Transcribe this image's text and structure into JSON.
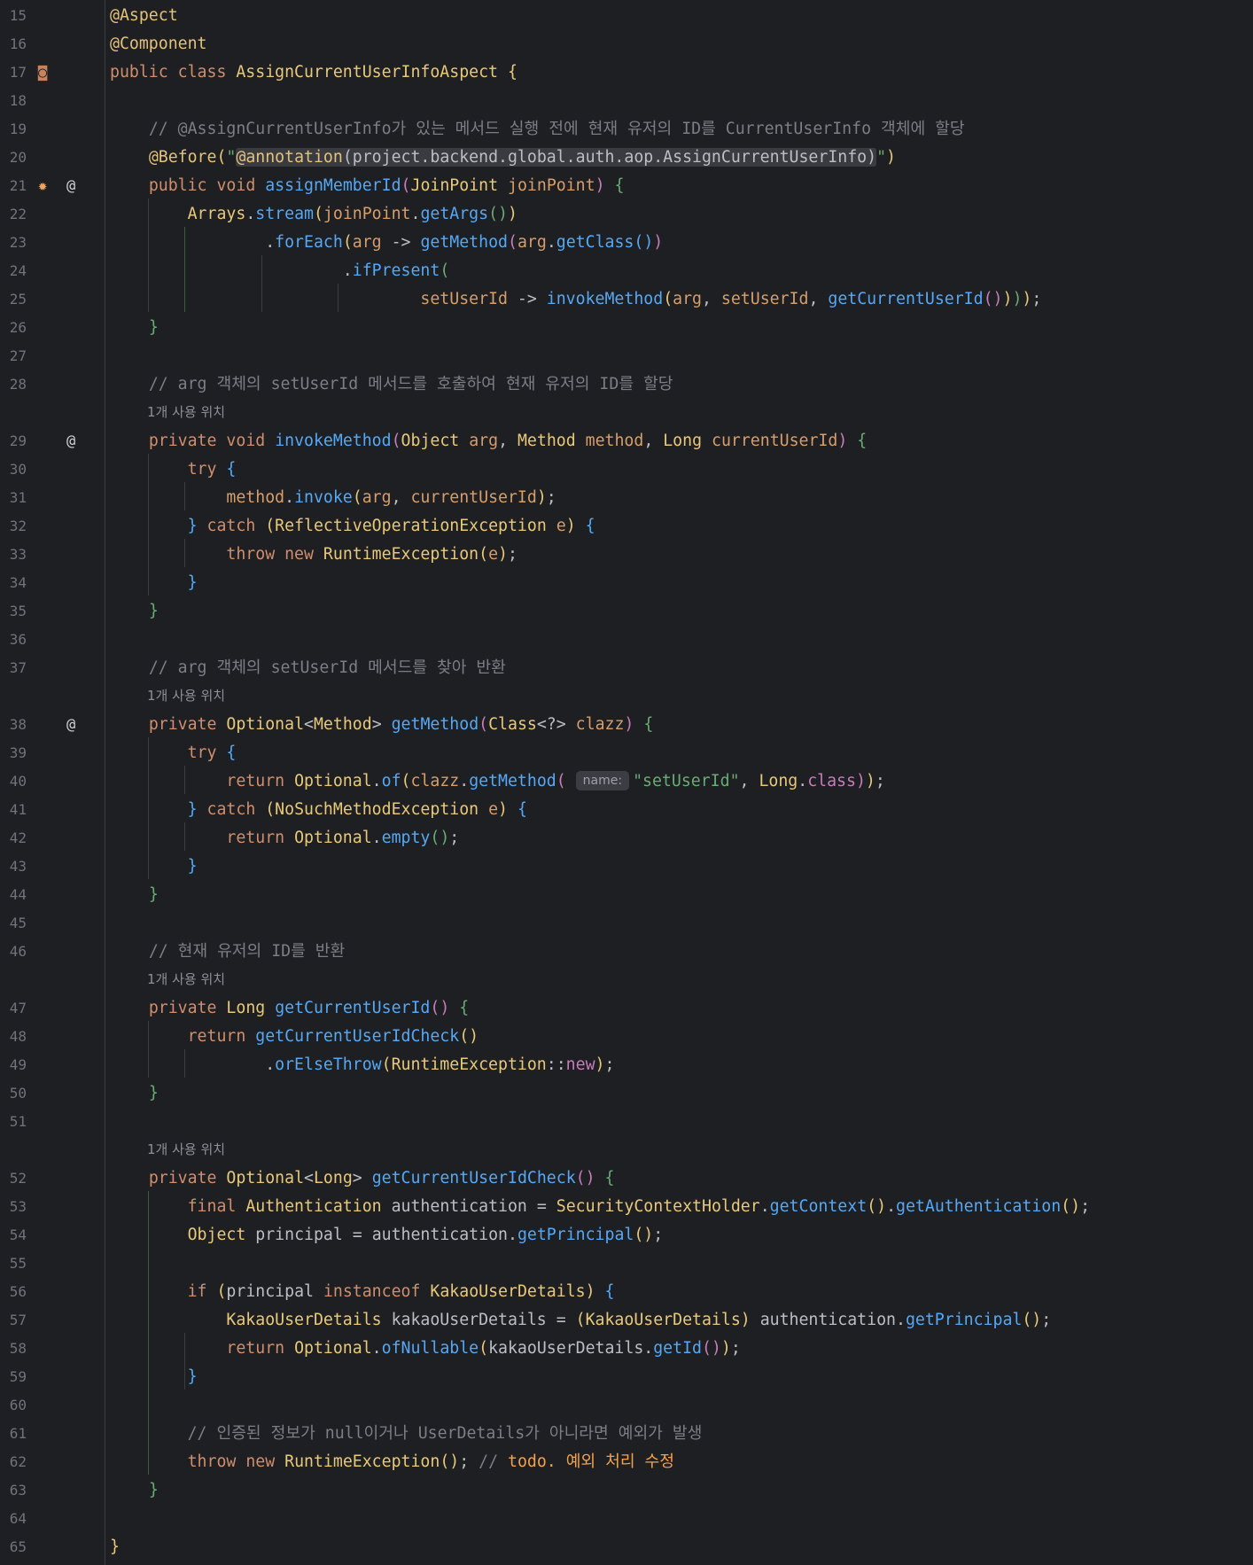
{
  "editor": {
    "language": "java",
    "theme_colors": {
      "background": "#1e1f22",
      "keyword": "#cf8e6d",
      "function": "#56a8f5",
      "type": "#e8c97a",
      "string": "#6aab73",
      "comment": "#7a7e85",
      "todo": "#f5a04a"
    },
    "usage_hint": "1개 사용 위치",
    "inlay_name": "name:",
    "gutter_icons": {
      "l17": "run-icon",
      "l21a": "bulb-icon",
      "at": "@"
    },
    "lines": {
      "n15": "15",
      "n16": "16",
      "n17": "17",
      "n18": "18",
      "n19": "19",
      "n20": "20",
      "n21": "21",
      "n22": "22",
      "n23": "23",
      "n24": "24",
      "n25": "25",
      "n26": "26",
      "n27": "27",
      "n28": "28",
      "n29": "29",
      "n30": "30",
      "n31": "31",
      "n32": "32",
      "n33": "33",
      "n34": "34",
      "n35": "35",
      "n36": "36",
      "n37": "37",
      "n38": "38",
      "n39": "39",
      "n40": "40",
      "n41": "41",
      "n42": "42",
      "n43": "43",
      "n44": "44",
      "n45": "45",
      "n46": "46",
      "n47": "47",
      "n48": "48",
      "n49": "49",
      "n50": "50",
      "n51": "51",
      "n52": "52",
      "n53": "53",
      "n54": "54",
      "n55": "55",
      "n56": "56",
      "n57": "57",
      "n58": "58",
      "n59": "59",
      "n60": "60",
      "n61": "61",
      "n62": "62",
      "n63": "63",
      "n64": "64",
      "n65": "65"
    },
    "t": {
      "aspect": "@Aspect",
      "component": "@Component",
      "public": "public",
      "class": "class",
      "void": "void",
      "private": "private",
      "try": "try",
      "catch": "catch",
      "throw": "throw",
      "new": "new",
      "return": "return",
      "final": "final",
      "if": "if",
      "instanceof": "instanceof",
      "className": "AssignCurrentUserInfoAspect",
      "c19": "// @AssignCurrentUserInfo가 있는 메서드 실행 전에 현재 유저의 ID를 CurrentUserInfo 객체에 할당",
      "before": "@Before",
      "annStr1": "\"",
      "annotationKw": "@annotation",
      "annBody": "(project.backend.global.auth.aop.AssignCurrentUserInfo)",
      "annStr2": "\"",
      "assignMemberId": "assignMemberId",
      "JoinPoint": "JoinPoint",
      "joinPoint": "joinPoint",
      "Arrays": "Arrays",
      "stream": "stream",
      "getArgs": "getArgs",
      "forEach": "forEach",
      "arg": "arg",
      "arrow": " -> ",
      "getMethod": "getMethod",
      "getClass": "getClass",
      "ifPresent": "ifPresent",
      "setUserId": "setUserId",
      "invokeMethod": "invokeMethod",
      "getCurrentUserId": "getCurrentUserId",
      "c28": "// arg 객체의 setUserId 메서드를 호출하여 현재 유저의 ID를 할당",
      "Object": "Object",
      "Method": "Method",
      "method": "method",
      "Long": "Long",
      "currentUserId": "currentUserId",
      "invoke": "invoke",
      "ReflectiveOperationException": "ReflectiveOperationException",
      "e": "e",
      "RuntimeException": "RuntimeException",
      "c37": "// arg 객체의 setUserId 메서드를 찾아 반환",
      "Optional": "Optional",
      "Class": "Class",
      "wild": "<?>",
      "clazz": "clazz",
      "of": "of",
      "setUserIdStr": "\"setUserId\"",
      "classKw": "class",
      "NoSuchMethodException": "NoSuchMethodException",
      "empty": "empty",
      "c46": "// 현재 유저의 ID를 반환",
      "getCurrentUserIdCheck": "getCurrentUserIdCheck",
      "orElseThrow": "orElseThrow",
      "methodRef": "::",
      "Authentication": "Authentication",
      "authentication": "authentication",
      "SecurityContextHolder": "SecurityContextHolder",
      "getContext": "getContext",
      "getAuthentication": "getAuthentication",
      "principal": "principal",
      "getPrincipal": "getPrincipal",
      "KakaoUserDetails": "KakaoUserDetails",
      "kakaoUserDetails": "kakaoUserDetails",
      "ofNullable": "ofNullable",
      "getId": "getId",
      "c61": "// 인증된 정보가 null이거나 UserDetails가 아니라면 예외가 발생",
      "c62a": "// ",
      "c62todo": "todo. 예외 처리 수정"
    }
  }
}
